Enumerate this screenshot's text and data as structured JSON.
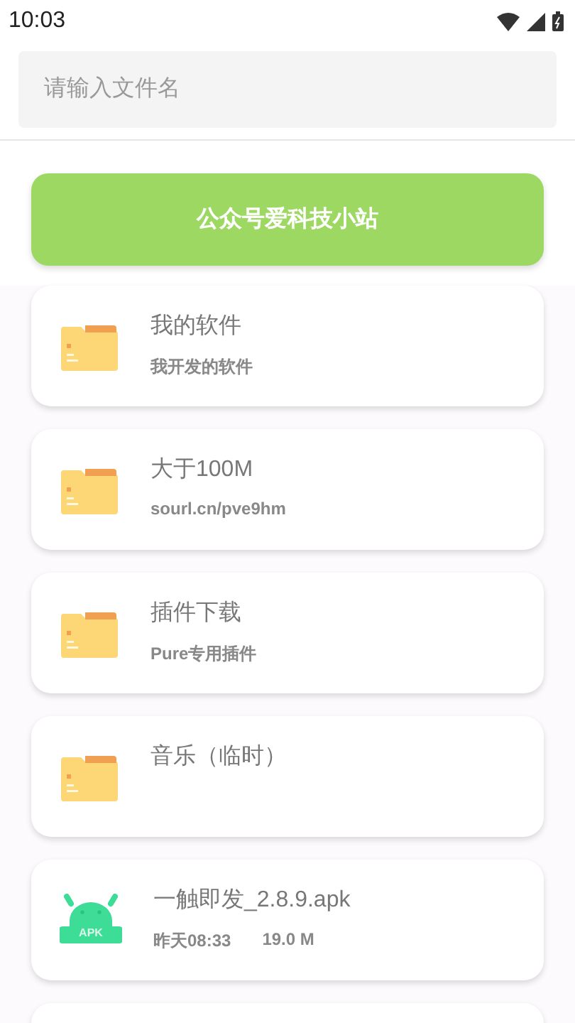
{
  "status_bar": {
    "time": "10:03"
  },
  "search": {
    "placeholder": "请输入文件名"
  },
  "banner_button": {
    "label": "公众号爱科技小站"
  },
  "files": [
    {
      "kind": "folder",
      "name": "我的软件",
      "subtitle": "我开发的软件"
    },
    {
      "kind": "folder",
      "name": "大于100M",
      "subtitle": "sourl.cn/pve9hm"
    },
    {
      "kind": "folder",
      "name": "插件下载",
      "subtitle": "Pure专用插件"
    },
    {
      "kind": "folder",
      "name": "音乐（临时）"
    },
    {
      "kind": "apk",
      "icon_label": "APK",
      "name": "一触即发_2.8.9.apk",
      "date": "昨天08:33",
      "size": "19.0 M"
    }
  ]
}
